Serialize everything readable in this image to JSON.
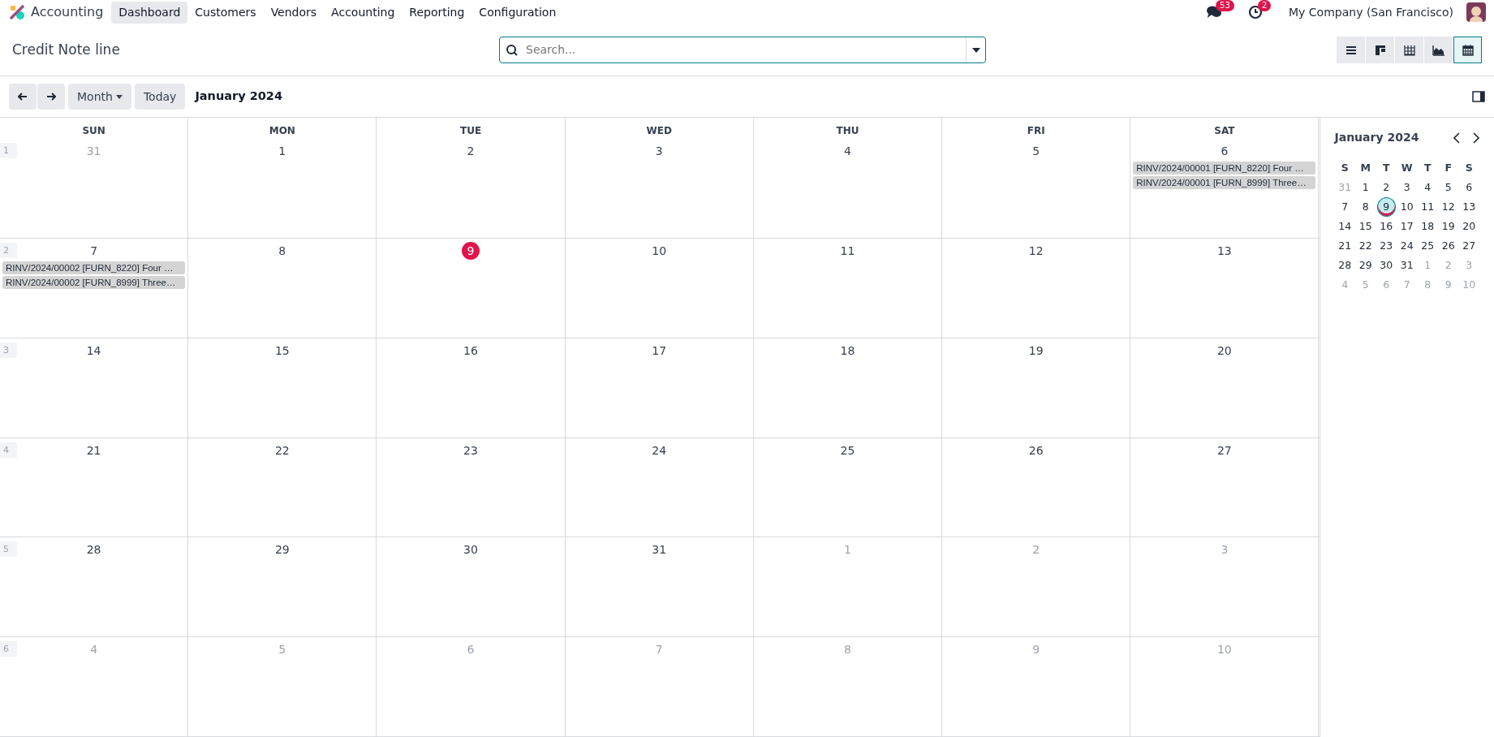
{
  "app": {
    "name": "Accounting"
  },
  "menu": [
    {
      "label": "Dashboard",
      "selected": true
    },
    {
      "label": "Customers",
      "selected": false
    },
    {
      "label": "Vendors",
      "selected": false
    },
    {
      "label": "Accounting",
      "selected": false
    },
    {
      "label": "Reporting",
      "selected": false
    },
    {
      "label": "Configuration",
      "selected": false
    }
  ],
  "systray": {
    "messages_count": "53",
    "activities_count": "2",
    "company": "My Company (San Francisco)"
  },
  "breadcrumb": "Credit Note line",
  "search": {
    "placeholder": "Search..."
  },
  "views": [
    {
      "kind": "list",
      "selected": false
    },
    {
      "kind": "kanban",
      "selected": false
    },
    {
      "kind": "pivot",
      "selected": false
    },
    {
      "kind": "graph",
      "selected": false
    },
    {
      "kind": "calendar",
      "selected": true
    }
  ],
  "toolbar": {
    "scale": "Month",
    "today": "Today",
    "period": "January 2024"
  },
  "calendar": {
    "weekdays": [
      "SUN",
      "MON",
      "TUE",
      "WED",
      "THU",
      "FRI",
      "SAT"
    ],
    "weeks": [
      {
        "number": "1",
        "days": [
          {
            "label": "31",
            "other_month": true,
            "today": false
          },
          {
            "label": "1",
            "other_month": false,
            "today": false
          },
          {
            "label": "2",
            "other_month": false,
            "today": false
          },
          {
            "label": "3",
            "other_month": false,
            "today": false
          },
          {
            "label": "4",
            "other_month": false,
            "today": false
          },
          {
            "label": "5",
            "other_month": false,
            "today": false
          },
          {
            "label": "6",
            "other_month": false,
            "today": false,
            "events": [
              "RINV/2024/00001 [FURN_8220] Four …",
              "RINV/2024/00001 [FURN_8999] Three…"
            ]
          }
        ]
      },
      {
        "number": "2",
        "days": [
          {
            "label": "7",
            "other_month": false,
            "today": false,
            "events": [
              "RINV/2024/00002 [FURN_8220] Four …",
              "RINV/2024/00002 [FURN_8999] Three…"
            ]
          },
          {
            "label": "8",
            "other_month": false,
            "today": false
          },
          {
            "label": "9",
            "other_month": false,
            "today": true
          },
          {
            "label": "10",
            "other_month": false,
            "today": false
          },
          {
            "label": "11",
            "other_month": false,
            "today": false
          },
          {
            "label": "12",
            "other_month": false,
            "today": false
          },
          {
            "label": "13",
            "other_month": false,
            "today": false
          }
        ]
      },
      {
        "number": "3",
        "days": [
          {
            "label": "14",
            "other_month": false,
            "today": false
          },
          {
            "label": "15",
            "other_month": false,
            "today": false
          },
          {
            "label": "16",
            "other_month": false,
            "today": false
          },
          {
            "label": "17",
            "other_month": false,
            "today": false
          },
          {
            "label": "18",
            "other_month": false,
            "today": false
          },
          {
            "label": "19",
            "other_month": false,
            "today": false
          },
          {
            "label": "20",
            "other_month": false,
            "today": false
          }
        ]
      },
      {
        "number": "4",
        "days": [
          {
            "label": "21",
            "other_month": false,
            "today": false
          },
          {
            "label": "22",
            "other_month": false,
            "today": false
          },
          {
            "label": "23",
            "other_month": false,
            "today": false
          },
          {
            "label": "24",
            "other_month": false,
            "today": false
          },
          {
            "label": "25",
            "other_month": false,
            "today": false
          },
          {
            "label": "26",
            "other_month": false,
            "today": false
          },
          {
            "label": "27",
            "other_month": false,
            "today": false
          }
        ]
      },
      {
        "number": "5",
        "days": [
          {
            "label": "28",
            "other_month": false,
            "today": false
          },
          {
            "label": "29",
            "other_month": false,
            "today": false
          },
          {
            "label": "30",
            "other_month": false,
            "today": false
          },
          {
            "label": "31",
            "other_month": false,
            "today": false
          },
          {
            "label": "1",
            "other_month": true,
            "today": false
          },
          {
            "label": "2",
            "other_month": true,
            "today": false
          },
          {
            "label": "3",
            "other_month": true,
            "today": false
          }
        ]
      },
      {
        "number": "6",
        "days": [
          {
            "label": "4",
            "other_month": true,
            "today": false
          },
          {
            "label": "5",
            "other_month": true,
            "today": false
          },
          {
            "label": "6",
            "other_month": true,
            "today": false
          },
          {
            "label": "7",
            "other_month": true,
            "today": false
          },
          {
            "label": "8",
            "other_month": true,
            "today": false
          },
          {
            "label": "9",
            "other_month": true,
            "today": false
          },
          {
            "label": "10",
            "other_month": true,
            "today": false
          }
        ]
      }
    ]
  },
  "mini_calendar": {
    "title": "January 2024",
    "weekdays": [
      "S",
      "M",
      "T",
      "W",
      "T",
      "F",
      "S"
    ],
    "weeks": [
      [
        {
          "label": "31",
          "other_month": true,
          "selected": false,
          "today": false
        },
        {
          "label": "1",
          "other_month": false,
          "selected": false,
          "today": false
        },
        {
          "label": "2",
          "other_month": false,
          "selected": false,
          "today": false
        },
        {
          "label": "3",
          "other_month": false,
          "selected": false,
          "today": false
        },
        {
          "label": "4",
          "other_month": false,
          "selected": false,
          "today": false
        },
        {
          "label": "5",
          "other_month": false,
          "selected": false,
          "today": false
        },
        {
          "label": "6",
          "other_month": false,
          "selected": false,
          "today": false
        }
      ],
      [
        {
          "label": "7",
          "other_month": false,
          "selected": false,
          "today": false
        },
        {
          "label": "8",
          "other_month": false,
          "selected": false,
          "today": false
        },
        {
          "label": "9",
          "other_month": false,
          "selected": true,
          "today": true
        },
        {
          "label": "10",
          "other_month": false,
          "selected": false,
          "today": false
        },
        {
          "label": "11",
          "other_month": false,
          "selected": false,
          "today": false
        },
        {
          "label": "12",
          "other_month": false,
          "selected": false,
          "today": false
        },
        {
          "label": "13",
          "other_month": false,
          "selected": false,
          "today": false
        }
      ],
      [
        {
          "label": "14",
          "other_month": false,
          "selected": false,
          "today": false
        },
        {
          "label": "15",
          "other_month": false,
          "selected": false,
          "today": false
        },
        {
          "label": "16",
          "other_month": false,
          "selected": false,
          "today": false
        },
        {
          "label": "17",
          "other_month": false,
          "selected": false,
          "today": false
        },
        {
          "label": "18",
          "other_month": false,
          "selected": false,
          "today": false
        },
        {
          "label": "19",
          "other_month": false,
          "selected": false,
          "today": false
        },
        {
          "label": "20",
          "other_month": false,
          "selected": false,
          "today": false
        }
      ],
      [
        {
          "label": "21",
          "other_month": false,
          "selected": false,
          "today": false
        },
        {
          "label": "22",
          "other_month": false,
          "selected": false,
          "today": false
        },
        {
          "label": "23",
          "other_month": false,
          "selected": false,
          "today": false
        },
        {
          "label": "24",
          "other_month": false,
          "selected": false,
          "today": false
        },
        {
          "label": "25",
          "other_month": false,
          "selected": false,
          "today": false
        },
        {
          "label": "26",
          "other_month": false,
          "selected": false,
          "today": false
        },
        {
          "label": "27",
          "other_month": false,
          "selected": false,
          "today": false
        }
      ],
      [
        {
          "label": "28",
          "other_month": false,
          "selected": false,
          "today": false
        },
        {
          "label": "29",
          "other_month": false,
          "selected": false,
          "today": false
        },
        {
          "label": "30",
          "other_month": false,
          "selected": false,
          "today": false
        },
        {
          "label": "31",
          "other_month": false,
          "selected": false,
          "today": false
        },
        {
          "label": "1",
          "other_month": true,
          "selected": false,
          "today": false
        },
        {
          "label": "2",
          "other_month": true,
          "selected": false,
          "today": false
        },
        {
          "label": "3",
          "other_month": true,
          "selected": false,
          "today": false
        }
      ],
      [
        {
          "label": "4",
          "other_month": true,
          "selected": false,
          "today": false
        },
        {
          "label": "5",
          "other_month": true,
          "selected": false,
          "today": false
        },
        {
          "label": "6",
          "other_month": true,
          "selected": false,
          "today": false
        },
        {
          "label": "7",
          "other_month": true,
          "selected": false,
          "today": false
        },
        {
          "label": "8",
          "other_month": true,
          "selected": false,
          "today": false
        },
        {
          "label": "9",
          "other_month": true,
          "selected": false,
          "today": false
        },
        {
          "label": "10",
          "other_month": true,
          "selected": false,
          "today": false
        }
      ]
    ]
  }
}
